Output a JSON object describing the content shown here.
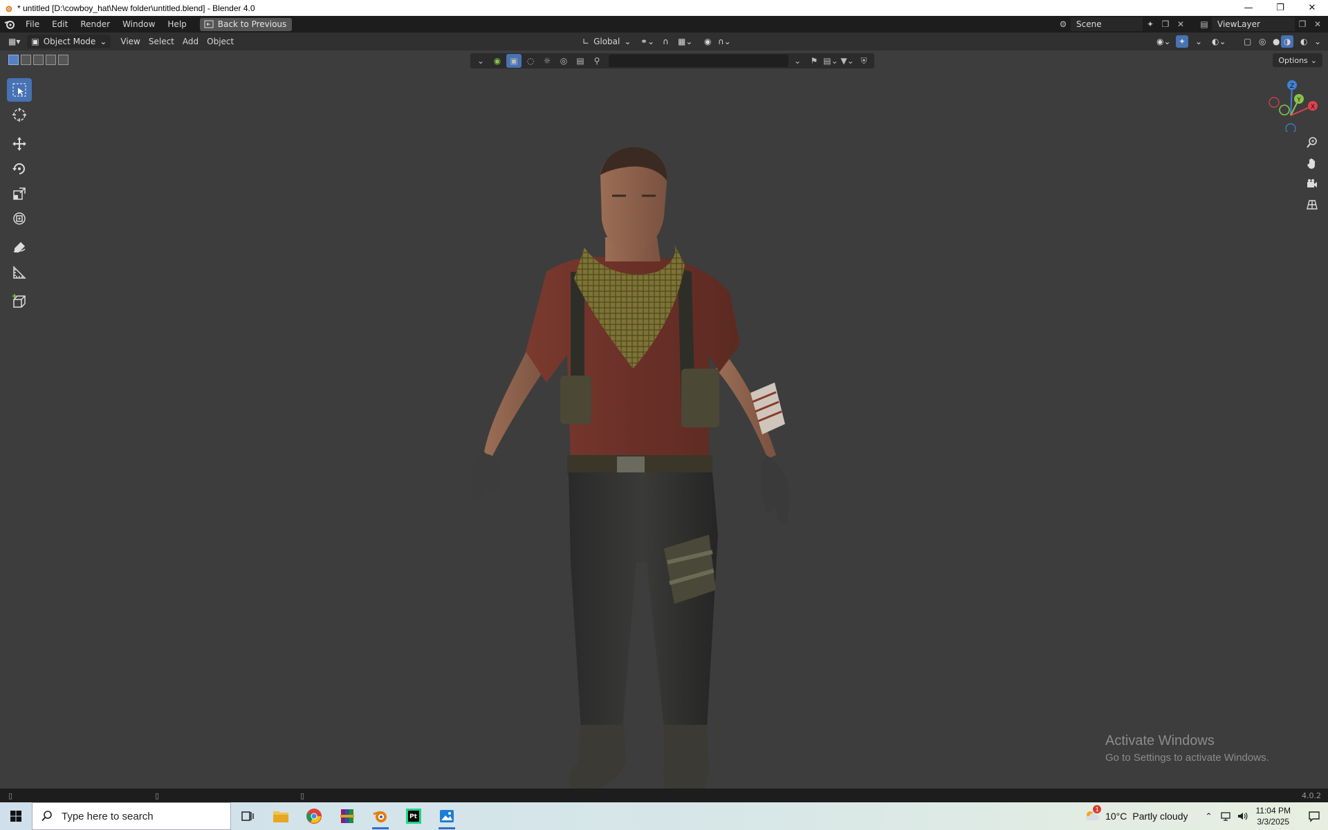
{
  "window": {
    "title": "* untitled [D:\\cowboy_hat\\New folder\\untitled.blend] - Blender 4.0"
  },
  "topbar": {
    "menus": [
      "File",
      "Edit",
      "Render",
      "Window",
      "Help"
    ],
    "back_button": "Back to Previous",
    "scene_name": "Scene",
    "view_layer": "ViewLayer"
  },
  "viewport_header": {
    "mode": "Object Mode",
    "menus": [
      "View",
      "Select",
      "Add",
      "Object"
    ],
    "transform_orientation": "Global",
    "options_label": "Options"
  },
  "gizmo": {
    "axes": [
      "Z",
      "Y",
      "X"
    ]
  },
  "overlay": {
    "activate_title": "Activate Windows",
    "activate_sub": "Go to Settings to activate Windows."
  },
  "statusbar": {
    "version": "4.0.2"
  },
  "taskbar": {
    "search_placeholder": "Type here to search",
    "weather_temp": "10°C",
    "weather_desc": "Partly cloudy",
    "time": "11:04 PM",
    "date": "3/3/2025",
    "notification_count": "1"
  },
  "colors": {
    "accent": "#4772b3",
    "x_axis": "#e0414b",
    "y_axis": "#8bc34a",
    "z_axis": "#3f82d6"
  }
}
